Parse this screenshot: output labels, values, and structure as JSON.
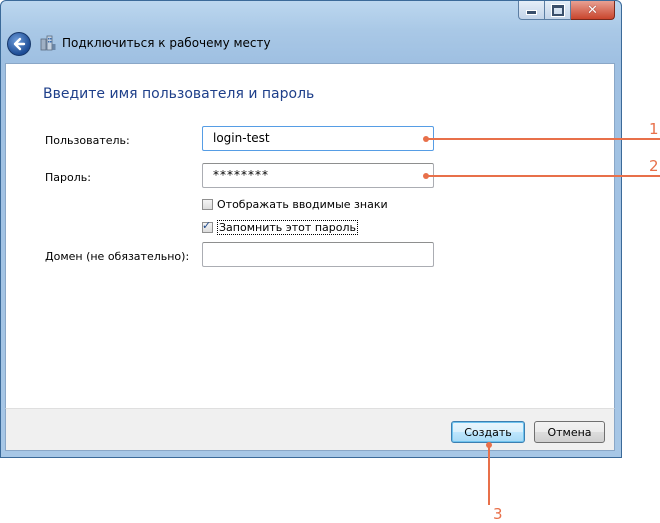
{
  "window": {
    "title": "Подключиться к рабочему месту"
  },
  "dialog": {
    "heading": "Введите имя пользователя и пароль",
    "user_label": "Пользователь:",
    "user_value": "login-test",
    "password_label": "Пароль:",
    "password_value": "********",
    "show_chars_label": "Отображать вводимые знаки",
    "show_chars_checked": false,
    "remember_label": "Запомнить этот пароль",
    "remember_checked": true,
    "domain_label": "Домен (не обязательно):",
    "domain_value": ""
  },
  "buttons": {
    "create_label": "Создать",
    "cancel_label": "Отмена"
  },
  "callouts": {
    "one": "1",
    "two": "2",
    "three": "3"
  },
  "colors": {
    "callout": "#e8704a",
    "heading": "#1e3f8a"
  }
}
